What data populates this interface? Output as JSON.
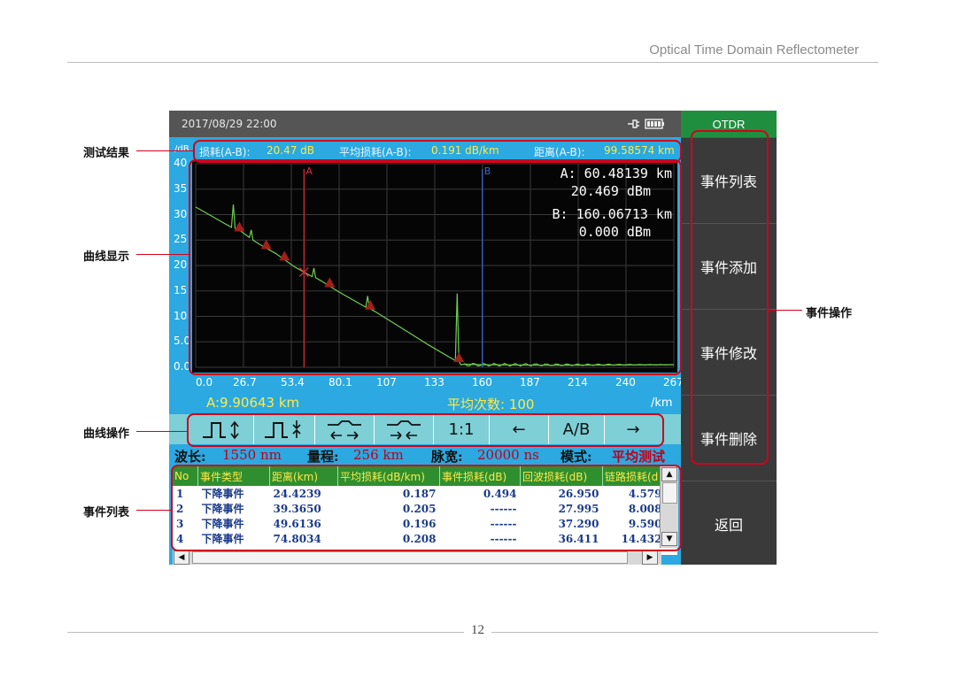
{
  "document": {
    "title": "Optical Time Domain Reflectometer",
    "page_number": "12"
  },
  "callouts": {
    "results": "测试结果",
    "curve_display": "曲线显示",
    "curve_ops": "曲线操作",
    "event_list": "事件列表",
    "event_ops": "事件操作"
  },
  "status": {
    "datetime": "2017/08/29  22:00",
    "battery_icon": "battery-icon",
    "plug_icon": "plug-icon"
  },
  "results": {
    "loss_label": "损耗(A-B):",
    "loss_value": "20.47 dB",
    "avg_loss_label": "平均损耗(A-B):",
    "avg_loss_value": "0.191 dB/km",
    "distance_label": "距离(A-B):",
    "distance_value": "99.58574 km"
  },
  "chart_data": {
    "type": "line",
    "ylabel": "/dB",
    "xlabel": "/km",
    "ylim": [
      0,
      40
    ],
    "xlim": [
      0,
      267
    ],
    "yticks": [
      "40",
      "35",
      "30",
      "25",
      "20",
      "15",
      "10",
      "5.0",
      "0.0"
    ],
    "xticks": [
      "0.0",
      "26.7",
      "53.4",
      "80.1",
      "107",
      "133",
      "160",
      "187",
      "214",
      "240",
      "267"
    ],
    "grid": true,
    "series": [
      {
        "x": [
          0,
          20,
          21,
          22,
          25,
          30,
          31,
          32,
          35,
          45,
          55,
          60,
          65,
          66,
          67,
          70,
          80,
          90,
          95,
          96,
          97,
          100,
          110,
          120,
          130,
          145,
          146,
          147,
          148,
          150,
          160,
          200,
          267
        ],
        "y": [
          31.5,
          27.5,
          32,
          27.3,
          26.8,
          25.5,
          27,
          25,
          24.3,
          22.3,
          19.8,
          18.8,
          17.8,
          19.5,
          17.6,
          17,
          14.8,
          12.8,
          11.8,
          14,
          11.6,
          11,
          8.8,
          6.6,
          4.4,
          1.3,
          14.5,
          1.2,
          0.5,
          0.6,
          0.5,
          0.4,
          0.5
        ]
      }
    ],
    "events_x": [
      24.4,
      39.4,
      49.6,
      74.8,
      97.5,
      147
    ],
    "cursor_a_x": 60.48139,
    "cursor_b_x": 160.06713,
    "cursor_a_label": "A",
    "cursor_b_label": "B",
    "trace_color": "#6fcf4f",
    "cursor_a_color": "#e0303a",
    "cursor_b_color": "#3a6ad6",
    "event_color": "#a0201a"
  },
  "cursor_info": {
    "a_dist": "A: 60.48139 km",
    "a_level": "20.469 dBm",
    "b_dist": "B: 160.06713 km",
    "b_level": "0.000 dBm"
  },
  "info": {
    "a_position": "A:9.90643 km",
    "averages": "平均次数: 100",
    "unit": "/km"
  },
  "toolbar": [
    "⎍↕",
    "⎍↕",
    "⇤⇥",
    "⇥⇤",
    "1:1",
    "←",
    "A/B",
    "→"
  ],
  "params": {
    "wavelength_label": "波长:",
    "wavelength_value": "1550 nm",
    "range_label": "量程:",
    "range_value": "256 km",
    "pulse_label": "脉宽:",
    "pulse_value": "20000 ns",
    "mode_label": "模式:",
    "mode_value": "平均测试"
  },
  "table": {
    "headers": [
      "No",
      "事件类型",
      "距离(km)",
      "平均损耗(dB/km)",
      "事件损耗(dB)",
      "回波损耗(dB)",
      "链路损耗(d"
    ],
    "rows": [
      [
        "1",
        "下降事件",
        "24.4239",
        "0.187",
        "0.494",
        "26.950",
        "4.579"
      ],
      [
        "2",
        "下降事件",
        "39.3650",
        "0.205",
        "------",
        "27.995",
        "8.008"
      ],
      [
        "3",
        "下降事件",
        "49.6136",
        "0.196",
        "------",
        "37.290",
        "9.590"
      ],
      [
        "4",
        "下降事件",
        "74.8034",
        "0.208",
        "------",
        "36.411",
        "14.432"
      ]
    ]
  },
  "side": {
    "header": "OTDR",
    "buttons": [
      "事件列表",
      "事件添加",
      "事件修改",
      "事件删除",
      "返回"
    ]
  }
}
